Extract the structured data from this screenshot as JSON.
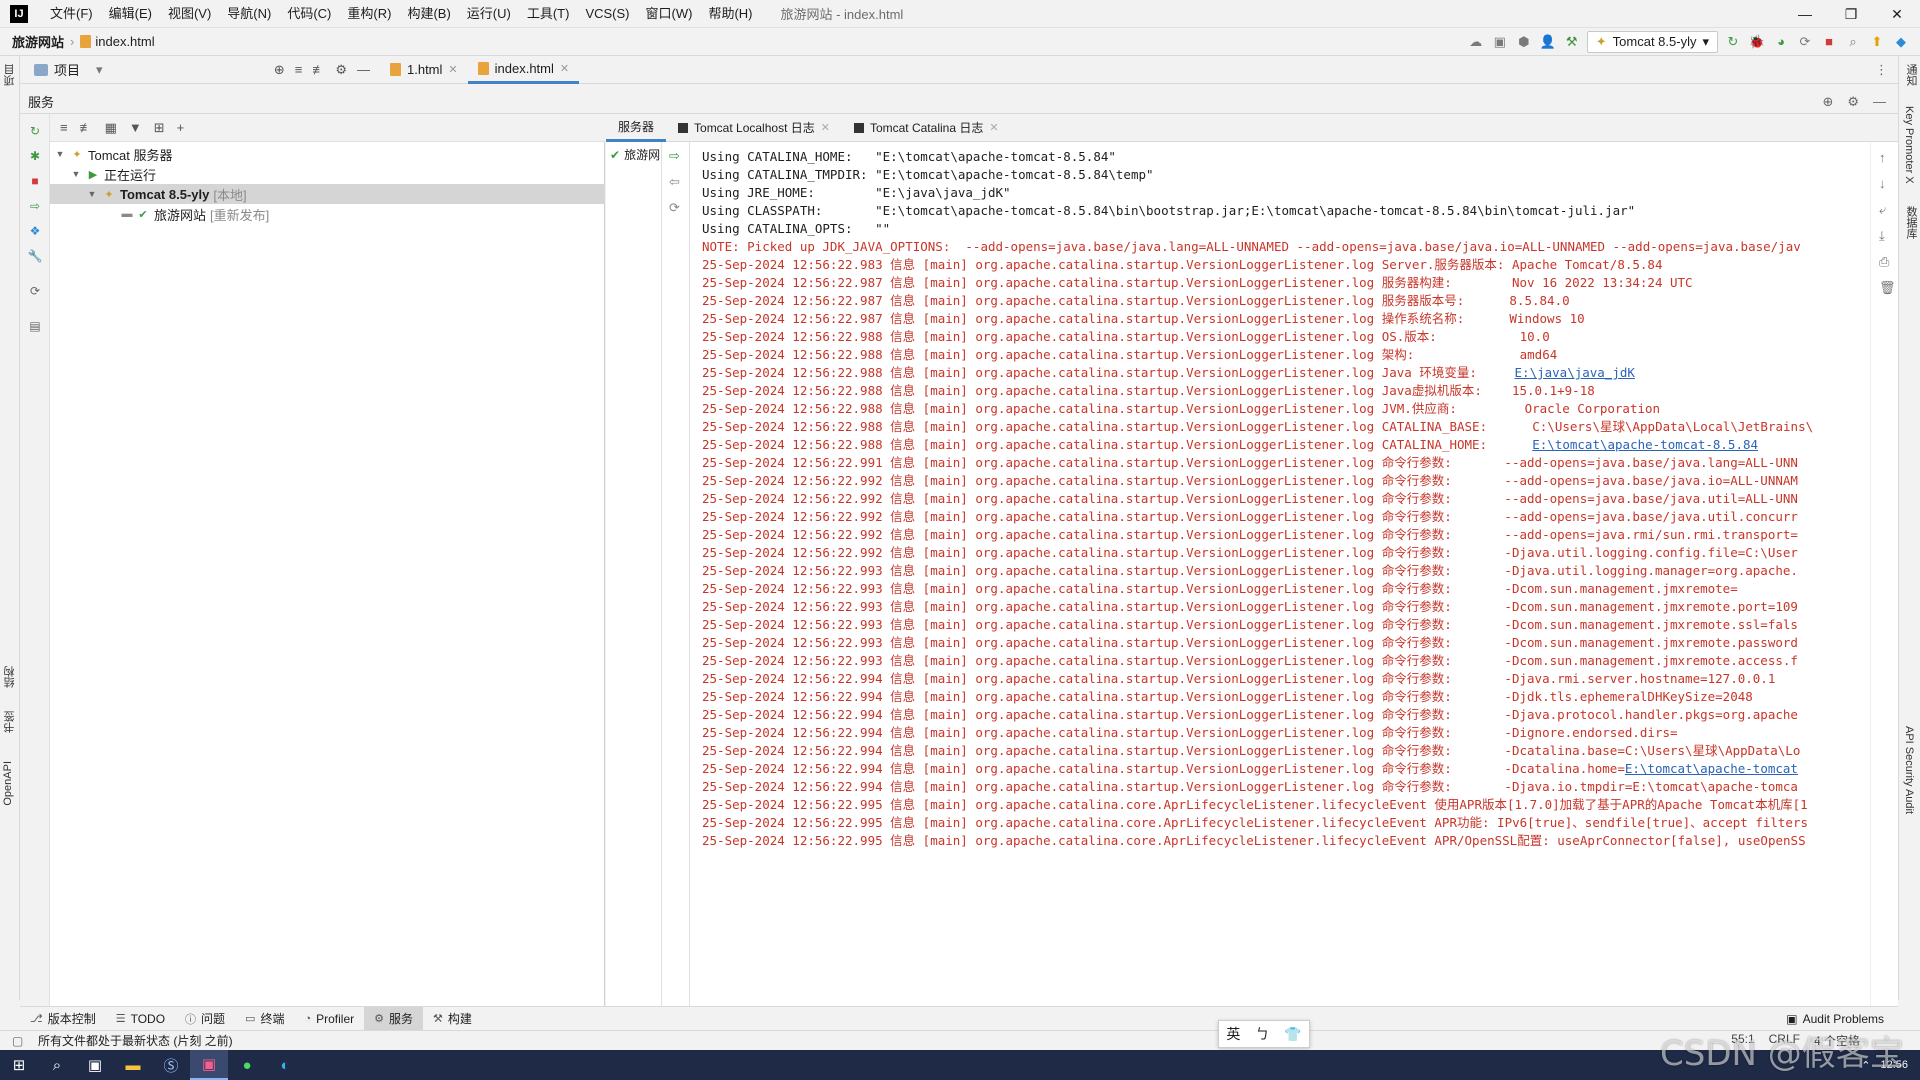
{
  "menubar": {
    "logo": "IJ",
    "items": [
      "文件(F)",
      "编辑(E)",
      "视图(V)",
      "导航(N)",
      "代码(C)",
      "重构(R)",
      "构建(B)",
      "运行(U)",
      "工具(T)",
      "VCS(S)",
      "窗口(W)",
      "帮助(H)"
    ],
    "title": "旅游网站 - index.html",
    "controls": [
      "—",
      "❐",
      "✕"
    ]
  },
  "navbar": {
    "project": "旅游网站",
    "file": "index.html",
    "run_config": "Tomcat 8.5-yly"
  },
  "project_bar": {
    "label": "项目",
    "tabs": [
      {
        "label": "1.html",
        "active": false
      },
      {
        "label": "index.html",
        "active": true
      }
    ]
  },
  "left_strip": {
    "project_tab": "项目",
    "structure_tab": "结构",
    "bookmarks_tab": "书签",
    "openapi_tab": "OpenAPI"
  },
  "right_strip": {
    "notifications": "通知",
    "key_promoter": "Key Promoter X",
    "database": "数据库",
    "api_security": "API Security Audit"
  },
  "services": {
    "header": "服务",
    "tree": [
      {
        "label": "Tomcat 服务器",
        "suffix": "",
        "level": 0
      },
      {
        "label": "正在运行",
        "suffix": "",
        "level": 1
      },
      {
        "label": "Tomcat 8.5-yly",
        "suffix": "[本地]",
        "level": 2
      },
      {
        "label": "旅游网站",
        "suffix": "[重新发布]",
        "level": 3
      }
    ],
    "deploy_item": "旅游网站"
  },
  "console_tabs": [
    {
      "label": "服务器",
      "active": true
    },
    {
      "label": "Tomcat Localhost 日志",
      "active": false
    },
    {
      "label": "Tomcat Catalina 日志",
      "active": false
    }
  ],
  "console": {
    "lines": [
      {
        "text": "Using CATALINA_HOME:   \"E:\\tomcat\\apache-tomcat-8.5.84\"",
        "plain": true
      },
      {
        "text": "Using CATALINA_TMPDIR: \"E:\\tomcat\\apache-tomcat-8.5.84\\temp\"",
        "plain": true
      },
      {
        "text": "Using JRE_HOME:        \"E:\\java\\java_jdK\"",
        "plain": true
      },
      {
        "text": "Using CLASSPATH:       \"E:\\tomcat\\apache-tomcat-8.5.84\\bin\\bootstrap.jar;E:\\tomcat\\apache-tomcat-8.5.84\\bin\\tomcat-juli.jar\"",
        "plain": true
      },
      {
        "text": "Using CATALINA_OPTS:   \"\"",
        "plain": true
      },
      {
        "text": "NOTE: Picked up JDK_JAVA_OPTIONS:  --add-opens=java.base/java.lang=ALL-UNNAMED --add-opens=java.base/java.io=ALL-UNNAMED --add-opens=java.base/jav",
        "plain": false
      },
      {
        "text": "25-Sep-2024 12:56:22.983 信息 [main] org.apache.catalina.startup.VersionLoggerListener.log Server.服务器版本: Apache Tomcat/8.5.84",
        "plain": false
      },
      {
        "text": "25-Sep-2024 12:56:22.987 信息 [main] org.apache.catalina.startup.VersionLoggerListener.log 服务器构建:        Nov 16 2022 13:34:24 UTC",
        "plain": false
      },
      {
        "text": "25-Sep-2024 12:56:22.987 信息 [main] org.apache.catalina.startup.VersionLoggerListener.log 服务器版本号:      8.5.84.0",
        "plain": false
      },
      {
        "text": "25-Sep-2024 12:56:22.987 信息 [main] org.apache.catalina.startup.VersionLoggerListener.log 操作系统名称:      Windows 10",
        "plain": false
      },
      {
        "text": "25-Sep-2024 12:56:22.988 信息 [main] org.apache.catalina.startup.VersionLoggerListener.log OS.版本:           10.0",
        "plain": false
      },
      {
        "text": "25-Sep-2024 12:56:22.988 信息 [main] org.apache.catalina.startup.VersionLoggerListener.log 架构:              amd64",
        "plain": false
      },
      {
        "text": "25-Sep-2024 12:56:22.988 信息 [main] org.apache.catalina.startup.VersionLoggerListener.log Java 环境变量:     ",
        "plain": false,
        "link": "E:\\java\\java_jdK"
      },
      {
        "text": "25-Sep-2024 12:56:22.988 信息 [main] org.apache.catalina.startup.VersionLoggerListener.log Java虚拟机版本:    15.0.1+9-18",
        "plain": false
      },
      {
        "text": "25-Sep-2024 12:56:22.988 信息 [main] org.apache.catalina.startup.VersionLoggerListener.log JVM.供应商:         Oracle Corporation",
        "plain": false
      },
      {
        "text": "25-Sep-2024 12:56:22.988 信息 [main] org.apache.catalina.startup.VersionLoggerListener.log CATALINA_BASE:      C:\\Users\\星球\\AppData\\Local\\JetBrains\\",
        "plain": false
      },
      {
        "text": "25-Sep-2024 12:56:22.988 信息 [main] org.apache.catalina.startup.VersionLoggerListener.log CATALINA_HOME:      ",
        "plain": false,
        "link": "E:\\tomcat\\apache-tomcat-8.5.84"
      },
      {
        "text": "25-Sep-2024 12:56:22.991 信息 [main] org.apache.catalina.startup.VersionLoggerListener.log 命令行参数:       --add-opens=java.base/java.lang=ALL-UNN",
        "plain": false
      },
      {
        "text": "25-Sep-2024 12:56:22.992 信息 [main] org.apache.catalina.startup.VersionLoggerListener.log 命令行参数:       --add-opens=java.base/java.io=ALL-UNNAM",
        "plain": false
      },
      {
        "text": "25-Sep-2024 12:56:22.992 信息 [main] org.apache.catalina.startup.VersionLoggerListener.log 命令行参数:       --add-opens=java.base/java.util=ALL-UNN",
        "plain": false
      },
      {
        "text": "25-Sep-2024 12:56:22.992 信息 [main] org.apache.catalina.startup.VersionLoggerListener.log 命令行参数:       --add-opens=java.base/java.util.concurr",
        "plain": false
      },
      {
        "text": "25-Sep-2024 12:56:22.992 信息 [main] org.apache.catalina.startup.VersionLoggerListener.log 命令行参数:       --add-opens=java.rmi/sun.rmi.transport=",
        "plain": false
      },
      {
        "text": "25-Sep-2024 12:56:22.992 信息 [main] org.apache.catalina.startup.VersionLoggerListener.log 命令行参数:       -Djava.util.logging.config.file=C:\\User",
        "plain": false
      },
      {
        "text": "25-Sep-2024 12:56:22.993 信息 [main] org.apache.catalina.startup.VersionLoggerListener.log 命令行参数:       -Djava.util.logging.manager=org.apache.",
        "plain": false
      },
      {
        "text": "25-Sep-2024 12:56:22.993 信息 [main] org.apache.catalina.startup.VersionLoggerListener.log 命令行参数:       -Dcom.sun.management.jmxremote=",
        "plain": false
      },
      {
        "text": "25-Sep-2024 12:56:22.993 信息 [main] org.apache.catalina.startup.VersionLoggerListener.log 命令行参数:       -Dcom.sun.management.jmxremote.port=109",
        "plain": false
      },
      {
        "text": "25-Sep-2024 12:56:22.993 信息 [main] org.apache.catalina.startup.VersionLoggerListener.log 命令行参数:       -Dcom.sun.management.jmxremote.ssl=fals",
        "plain": false
      },
      {
        "text": "25-Sep-2024 12:56:22.993 信息 [main] org.apache.catalina.startup.VersionLoggerListener.log 命令行参数:       -Dcom.sun.management.jmxremote.password",
        "plain": false
      },
      {
        "text": "25-Sep-2024 12:56:22.993 信息 [main] org.apache.catalina.startup.VersionLoggerListener.log 命令行参数:       -Dcom.sun.management.jmxremote.access.f",
        "plain": false
      },
      {
        "text": "25-Sep-2024 12:56:22.994 信息 [main] org.apache.catalina.startup.VersionLoggerListener.log 命令行参数:       -Djava.rmi.server.hostname=127.0.0.1",
        "plain": false
      },
      {
        "text": "25-Sep-2024 12:56:22.994 信息 [main] org.apache.catalina.startup.VersionLoggerListener.log 命令行参数:       -Djdk.tls.ephemeralDHKeySize=2048",
        "plain": false
      },
      {
        "text": "25-Sep-2024 12:56:22.994 信息 [main] org.apache.catalina.startup.VersionLoggerListener.log 命令行参数:       -Djava.protocol.handler.pkgs=org.apache",
        "plain": false
      },
      {
        "text": "25-Sep-2024 12:56:22.994 信息 [main] org.apache.catalina.startup.VersionLoggerListener.log 命令行参数:       -Dignore.endorsed.dirs=",
        "plain": false
      },
      {
        "text": "25-Sep-2024 12:56:22.994 信息 [main] org.apache.catalina.startup.VersionLoggerListener.log 命令行参数:       -Dcatalina.base=C:\\Users\\星球\\AppData\\Lo",
        "plain": false
      },
      {
        "text": "25-Sep-2024 12:56:22.994 信息 [main] org.apache.catalina.startup.VersionLoggerListener.log 命令行参数:       -Dcatalina.home=",
        "plain": false,
        "link": "E:\\tomcat\\apache-tomcat"
      },
      {
        "text": "25-Sep-2024 12:56:22.994 信息 [main] org.apache.catalina.startup.VersionLoggerListener.log 命令行参数:       -Djava.io.tmpdir=E:\\tomcat\\apache-tomca",
        "plain": false
      },
      {
        "text": "25-Sep-2024 12:56:22.995 信息 [main] org.apache.catalina.core.AprLifecycleListener.lifecycleEvent 使用APR版本[1.7.0]加载了基于APR的Apache Tomcat本机库[1",
        "plain": false
      },
      {
        "text": "25-Sep-2024 12:56:22.995 信息 [main] org.apache.catalina.core.AprLifecycleListener.lifecycleEvent APR功能: IPv6[true]、sendfile[true]、accept filters",
        "plain": false
      },
      {
        "text": "25-Sep-2024 12:56:22.995 信息 [main] org.apache.catalina.core.AprLifecycleListener.lifecycleEvent APR/OpenSSL配置: useAprConnector[false], useOpenSS",
        "plain": false
      }
    ]
  },
  "bottom_tabs": [
    {
      "label": "版本控制",
      "icon": "version-control-icon",
      "active": false
    },
    {
      "label": "TODO",
      "icon": "todo-icon",
      "active": false
    },
    {
      "label": "问题",
      "icon": "problems-icon",
      "active": false
    },
    {
      "label": "终端",
      "icon": "terminal-icon",
      "active": false
    },
    {
      "label": "Profiler",
      "icon": "profiler-icon",
      "active": false
    },
    {
      "label": "服务",
      "icon": "services-icon",
      "active": true
    },
    {
      "label": "构建",
      "icon": "build-icon",
      "active": false
    }
  ],
  "audit_problems": "Audit Problems",
  "statusbar": {
    "message": "所有文件都处于最新状态 (片刻 之前)",
    "position": "55:1",
    "line_sep": "CRLF",
    "indent": "4 个空格"
  },
  "ime": {
    "lang": "英",
    "mode": "ㄅ",
    "skin": "shirt-icon"
  },
  "taskbar": {
    "time": "12:56"
  },
  "watermark": "CSDN @假客宝"
}
